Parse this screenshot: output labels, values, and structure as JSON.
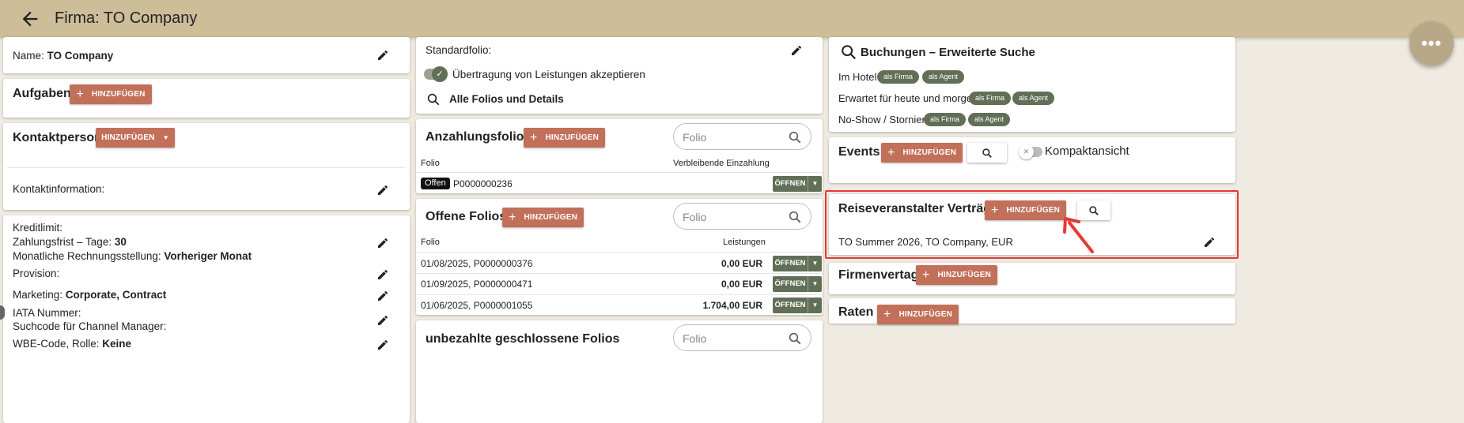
{
  "header": {
    "title": "Firma: TO Company",
    "back_icon": "arrow-back-icon",
    "more_icon": "more-horiz-icon",
    "more_label": "•••"
  },
  "left": {
    "name_label": "Name: ",
    "name_value": "TO Company",
    "tasks_title": "Aufgaben",
    "tasks_add": "HINZUFÜGEN",
    "contact_title": "Kontaktperson",
    "contact_add": "HINZUFÜGEN",
    "contact_info": "Kontaktinformation:",
    "credit_limit": "Kreditlimit:",
    "payment_terms_label": "Zahlungsfrist – Tage: ",
    "payment_terms_value": "30",
    "monthly_billing_label": "Monatliche Rechnungsstellung: ",
    "monthly_billing_value": "Vorheriger Monat",
    "commission": "Provision:",
    "marketing_label": "Marketing: ",
    "marketing_value": "Corporate, Contract",
    "iata": "IATA Nummer:",
    "searchcode": "Suchcode für Channel Manager:",
    "wbe_label": "WBE-Code, Rolle: ",
    "wbe_value": "Keine"
  },
  "middle": {
    "standard_folio": "Standardfolio:",
    "accept_transfer": "Übertragung von Leistungen akzeptieren",
    "all_folios": "Alle Folios und Details",
    "deposit": {
      "title": "Anzahlungsfolios",
      "add": "HINZUFÜGEN",
      "search_placeholder": "Folio",
      "col_folio": "Folio",
      "col_remaining": "Verbleibende Einzahlung",
      "rows": [
        {
          "status": "Offen",
          "folio": "P0000000236",
          "action": "ÖFFNEN"
        }
      ]
    },
    "open": {
      "title": "Offene Folios",
      "add": "HINZUFÜGEN",
      "search_placeholder": "Folio",
      "col_folio": "Folio",
      "col_services": "Leistungen",
      "rows": [
        {
          "folio": "01/08/2025,  P0000000376",
          "amount": "0,00 EUR",
          "action": "ÖFFNEN"
        },
        {
          "folio": "01/09/2025,  P0000000471",
          "amount": "0,00 EUR",
          "action": "ÖFFNEN"
        },
        {
          "folio": "01/06/2025,  P0000001055",
          "amount": "1.704,00 EUR",
          "action": "ÖFFNEN"
        }
      ]
    },
    "unpaid": {
      "title": "unbezahlte geschlossene Folios",
      "search_placeholder": "Folio"
    }
  },
  "right": {
    "bookings_title": "Buchungen – Erweiterte Suche",
    "in_hotel": "Im Hotel",
    "expected": "Erwartet für heute und morgen",
    "noshow": "No-Show / Storniert",
    "tag_firm": "als Firma",
    "tag_agent": "als Agent",
    "events_title": "Events",
    "events_add": "HINZUFÜGEN",
    "compact_view": "Kompaktansicht",
    "tour_title": "Reiseveranstalter Verträge",
    "tour_add": "HINZUFÜGEN",
    "tour_contract": "TO Summer 2026, TO Company, EUR",
    "company_contract_title": "Firmenvertag",
    "company_contract_add": "HINZUFÜGEN",
    "rates_title": "Raten",
    "rates_add": "HINZUFÜGEN"
  },
  "colors": {
    "topbar": "#cdbd99",
    "accent": "#c2705a",
    "tag": "#626f57",
    "highlight": "#e53935"
  }
}
